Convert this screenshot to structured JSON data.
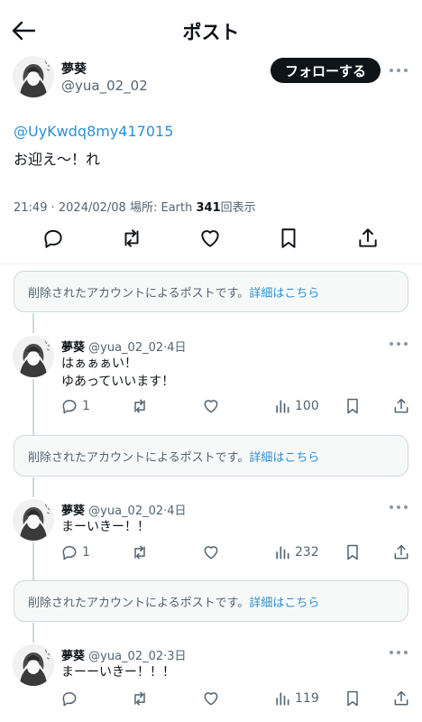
{
  "header": {
    "title": "ポスト"
  },
  "main_post": {
    "name": "夢葵",
    "handle": "@yua_02_02",
    "follow_label": "フォローする",
    "mention": "@UyKwdq8my417015",
    "text": "お迎え〜！れ",
    "time": "21:49",
    "date": "2024/02/08",
    "location_label": "場所: Earth",
    "views_count": "341",
    "views_label": "回表示",
    "separator": "·"
  },
  "deleted_notice": {
    "text": "削除されたアカウントによるポストです。",
    "link": "詳細はこちら"
  },
  "replies": [
    {
      "name": "夢葵",
      "handle": "@yua_02_02",
      "age": "4日",
      "lines": [
        "はぁぁぁい！",
        "ゆあっていいます！"
      ],
      "reply_count": "1",
      "views": "100"
    },
    {
      "name": "夢葵",
      "handle": "@yua_02_02",
      "age": "4日",
      "lines": [
        "まーいきー！！"
      ],
      "reply_count": "1",
      "views": "232"
    },
    {
      "name": "夢葵",
      "handle": "@yua_02_02",
      "age": "3日",
      "lines": [
        "まーーいきー！！！"
      ],
      "reply_count": "",
      "views": "119"
    }
  ],
  "icons": [
    "back-arrow-icon",
    "reply-icon",
    "repost-icon",
    "like-icon",
    "bookmark-icon",
    "share-icon",
    "views-icon",
    "more-icon"
  ]
}
